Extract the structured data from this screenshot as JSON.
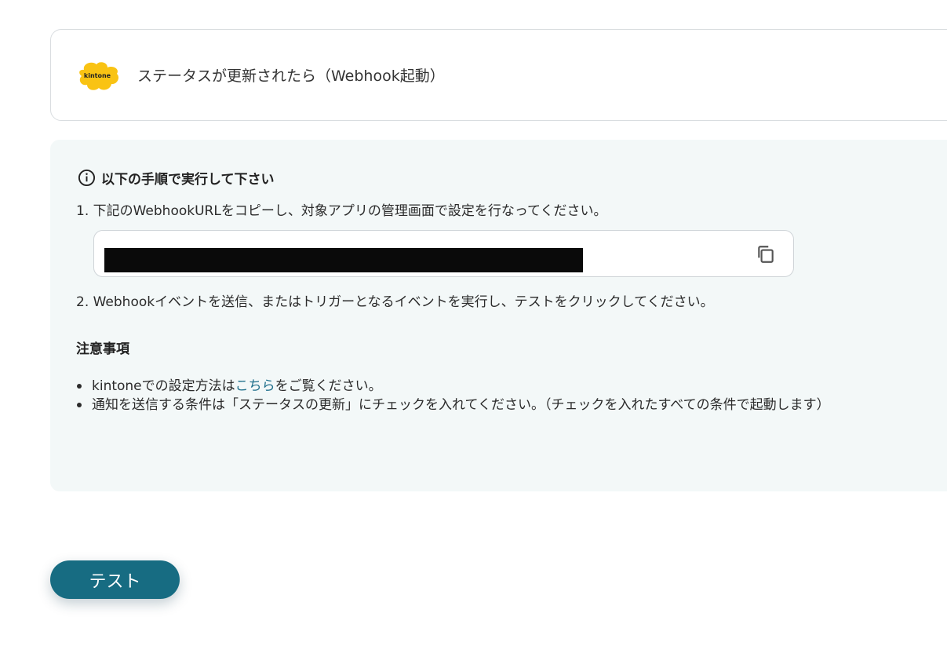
{
  "trigger": {
    "app_icon": "kintone-logo",
    "logo_text": "kintone",
    "title": "ステータスが更新されたら（Webhook起動）"
  },
  "instructions": {
    "heading_icon": "info-circle-icon",
    "heading": "以下の手順で実行して下さい",
    "step1": "1. 下記のWebhookURLをコピーし、対象アプリの管理画面で設定を行なってください。",
    "webhook_url": "",
    "copy_icon": "copy-icon",
    "step2": "2. Webhookイベントを送信、またはトリガーとなるイベントを実行し、テストをクリックしてください。"
  },
  "caution": {
    "heading": "注意事項",
    "note1_before": "kintoneでの設定方法は",
    "note1_link": "こちら",
    "note1_after": "をご覧ください。",
    "note2": "通知を送信する条件は「ステータスの更新」にチェックを入れてください。（チェックを入れたすべての条件で起動します）"
  },
  "actions": {
    "test_label": "テスト"
  },
  "colors": {
    "accent": "#176c82",
    "panel_bg": "#f3f8f8",
    "kintone_yellow": "#f9c313",
    "link": "#1f6f8b"
  }
}
